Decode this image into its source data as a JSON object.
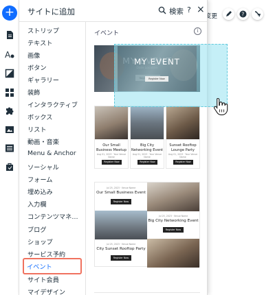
{
  "panel": {
    "title": "サイトに追加",
    "search_label": "検索",
    "help_label": "?",
    "close_label": "×"
  },
  "topbar": {
    "change_label": "変更"
  },
  "left_toolbar": {
    "add_label": "+",
    "icons": [
      "pages-icon",
      "theme-icon",
      "background-icon",
      "apps-icon",
      "puzzle-icon",
      "media-icon",
      "cms-icon",
      "business-icon"
    ]
  },
  "categories": [
    "ストリップ",
    "テキスト",
    "画像",
    "ボタン",
    "ギャラリー",
    "装飾",
    "インタラクティブ",
    "ボックス",
    "リスト",
    "動画・音楽",
    "Menu & Anchor",
    "ソーシャル",
    "フォーム",
    "埋め込み",
    "入力欄",
    "コンテンツマネージ...",
    "ブログ",
    "ショップ",
    "サービス予約",
    "イベント",
    "サイト会員",
    "マイデザイン"
  ],
  "active_category": "イベント",
  "section": {
    "title": "イベント",
    "info_label": "i"
  },
  "hero": {
    "title": "MY EVENT",
    "subtitle": "Date Location",
    "button": "Register Now"
  },
  "tri_events": [
    {
      "name": "Our Small Business Meetup",
      "date": "Aug 01, 2023 · Your Venue Name",
      "button": "Register Now"
    },
    {
      "name": "Big City Networking Event",
      "date": "Aug 01, 2023 · Your Venue Name",
      "button": "Register Now"
    },
    {
      "name": "Sunset Rooftop Lounge Party",
      "date": "Aug 01, 2023 · Your Venue Name",
      "button": "Register Now"
    }
  ],
  "list_events": [
    {
      "name": "Our Small Business Event",
      "date": "Jul 25, 2023 · Venue Name",
      "button": "Register Now"
    },
    {
      "name": "Big City Networking Event",
      "date": "Jul 25, 2023 · Venue Name",
      "button": "Register Now"
    },
    {
      "name": "City Sunset Rooftop Party",
      "date": "Jul 25, 2023 · Venue Name",
      "button": "Register Now"
    }
  ],
  "colors": {
    "accent": "#116dff",
    "highlight": "#f0715e",
    "drag_ghost": "#96e1f0"
  }
}
